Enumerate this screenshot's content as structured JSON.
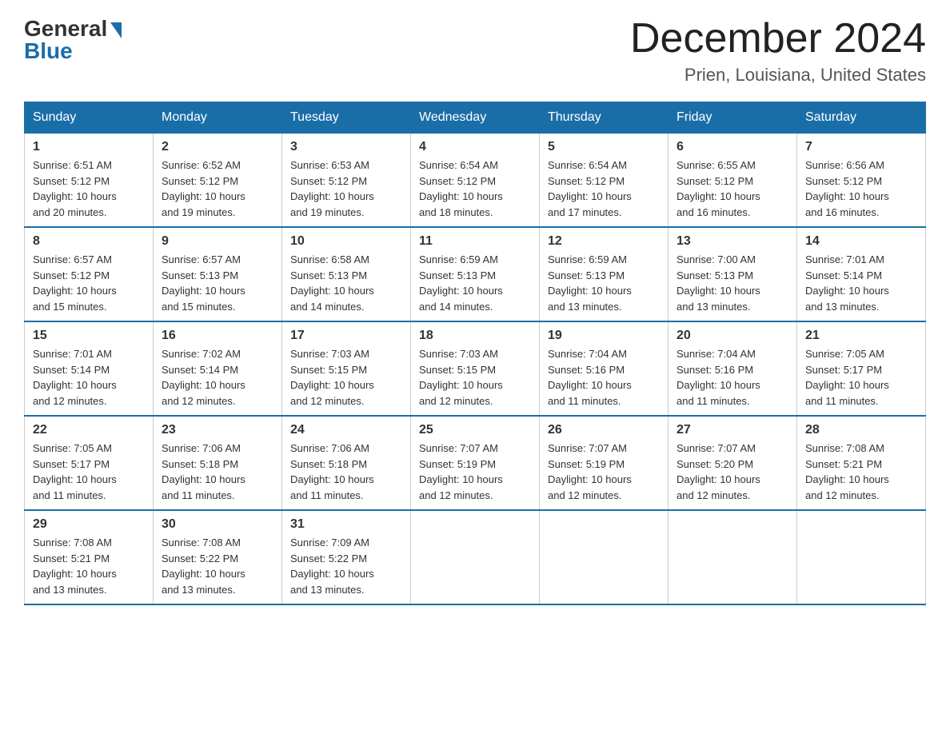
{
  "logo": {
    "general": "General",
    "blue": "Blue"
  },
  "title": {
    "month_year": "December 2024",
    "location": "Prien, Louisiana, United States"
  },
  "days_of_week": [
    "Sunday",
    "Monday",
    "Tuesday",
    "Wednesday",
    "Thursday",
    "Friday",
    "Saturday"
  ],
  "weeks": [
    [
      {
        "day": "1",
        "sunrise": "6:51 AM",
        "sunset": "5:12 PM",
        "daylight": "10 hours and 20 minutes."
      },
      {
        "day": "2",
        "sunrise": "6:52 AM",
        "sunset": "5:12 PM",
        "daylight": "10 hours and 19 minutes."
      },
      {
        "day": "3",
        "sunrise": "6:53 AM",
        "sunset": "5:12 PM",
        "daylight": "10 hours and 19 minutes."
      },
      {
        "day": "4",
        "sunrise": "6:54 AM",
        "sunset": "5:12 PM",
        "daylight": "10 hours and 18 minutes."
      },
      {
        "day": "5",
        "sunrise": "6:54 AM",
        "sunset": "5:12 PM",
        "daylight": "10 hours and 17 minutes."
      },
      {
        "day": "6",
        "sunrise": "6:55 AM",
        "sunset": "5:12 PM",
        "daylight": "10 hours and 16 minutes."
      },
      {
        "day": "7",
        "sunrise": "6:56 AM",
        "sunset": "5:12 PM",
        "daylight": "10 hours and 16 minutes."
      }
    ],
    [
      {
        "day": "8",
        "sunrise": "6:57 AM",
        "sunset": "5:12 PM",
        "daylight": "10 hours and 15 minutes."
      },
      {
        "day": "9",
        "sunrise": "6:57 AM",
        "sunset": "5:13 PM",
        "daylight": "10 hours and 15 minutes."
      },
      {
        "day": "10",
        "sunrise": "6:58 AM",
        "sunset": "5:13 PM",
        "daylight": "10 hours and 14 minutes."
      },
      {
        "day": "11",
        "sunrise": "6:59 AM",
        "sunset": "5:13 PM",
        "daylight": "10 hours and 14 minutes."
      },
      {
        "day": "12",
        "sunrise": "6:59 AM",
        "sunset": "5:13 PM",
        "daylight": "10 hours and 13 minutes."
      },
      {
        "day": "13",
        "sunrise": "7:00 AM",
        "sunset": "5:13 PM",
        "daylight": "10 hours and 13 minutes."
      },
      {
        "day": "14",
        "sunrise": "7:01 AM",
        "sunset": "5:14 PM",
        "daylight": "10 hours and 13 minutes."
      }
    ],
    [
      {
        "day": "15",
        "sunrise": "7:01 AM",
        "sunset": "5:14 PM",
        "daylight": "10 hours and 12 minutes."
      },
      {
        "day": "16",
        "sunrise": "7:02 AM",
        "sunset": "5:14 PM",
        "daylight": "10 hours and 12 minutes."
      },
      {
        "day": "17",
        "sunrise": "7:03 AM",
        "sunset": "5:15 PM",
        "daylight": "10 hours and 12 minutes."
      },
      {
        "day": "18",
        "sunrise": "7:03 AM",
        "sunset": "5:15 PM",
        "daylight": "10 hours and 12 minutes."
      },
      {
        "day": "19",
        "sunrise": "7:04 AM",
        "sunset": "5:16 PM",
        "daylight": "10 hours and 11 minutes."
      },
      {
        "day": "20",
        "sunrise": "7:04 AM",
        "sunset": "5:16 PM",
        "daylight": "10 hours and 11 minutes."
      },
      {
        "day": "21",
        "sunrise": "7:05 AM",
        "sunset": "5:17 PM",
        "daylight": "10 hours and 11 minutes."
      }
    ],
    [
      {
        "day": "22",
        "sunrise": "7:05 AM",
        "sunset": "5:17 PM",
        "daylight": "10 hours and 11 minutes."
      },
      {
        "day": "23",
        "sunrise": "7:06 AM",
        "sunset": "5:18 PM",
        "daylight": "10 hours and 11 minutes."
      },
      {
        "day": "24",
        "sunrise": "7:06 AM",
        "sunset": "5:18 PM",
        "daylight": "10 hours and 11 minutes."
      },
      {
        "day": "25",
        "sunrise": "7:07 AM",
        "sunset": "5:19 PM",
        "daylight": "10 hours and 12 minutes."
      },
      {
        "day": "26",
        "sunrise": "7:07 AM",
        "sunset": "5:19 PM",
        "daylight": "10 hours and 12 minutes."
      },
      {
        "day": "27",
        "sunrise": "7:07 AM",
        "sunset": "5:20 PM",
        "daylight": "10 hours and 12 minutes."
      },
      {
        "day": "28",
        "sunrise": "7:08 AM",
        "sunset": "5:21 PM",
        "daylight": "10 hours and 12 minutes."
      }
    ],
    [
      {
        "day": "29",
        "sunrise": "7:08 AM",
        "sunset": "5:21 PM",
        "daylight": "10 hours and 13 minutes."
      },
      {
        "day": "30",
        "sunrise": "7:08 AM",
        "sunset": "5:22 PM",
        "daylight": "10 hours and 13 minutes."
      },
      {
        "day": "31",
        "sunrise": "7:09 AM",
        "sunset": "5:22 PM",
        "daylight": "10 hours and 13 minutes."
      },
      null,
      null,
      null,
      null
    ]
  ],
  "labels": {
    "sunrise": "Sunrise:",
    "sunset": "Sunset:",
    "daylight": "Daylight:"
  }
}
